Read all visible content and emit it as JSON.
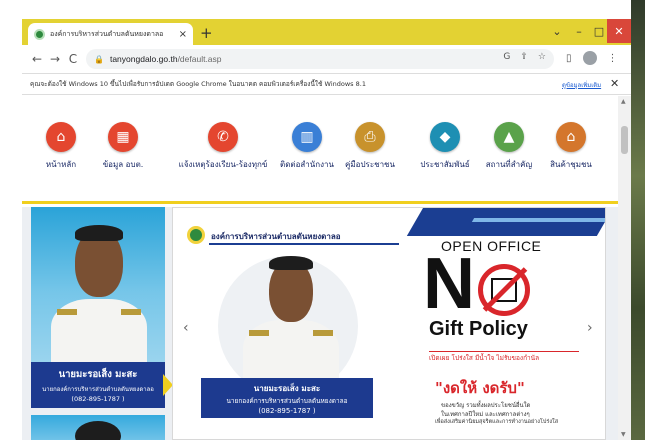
{
  "browser": {
    "tab_title": "องค์การบริหารส่วนตำบลตันหยงดาลอ",
    "tab_close": "×",
    "new_tab": "+",
    "url_host": "tanyongdalo.go.th",
    "url_path": "/default.asp",
    "window_controls": {
      "chevron": "⌄",
      "minimize": "–",
      "maximize": "□",
      "close": "✕"
    },
    "nav": {
      "back": "←",
      "forward": "→",
      "reload": "C"
    }
  },
  "infobar": {
    "message": "คุณจะต้องใช้ Windows 10 ขึ้นไปเพื่อรับการอัปเดต Google Chrome ในอนาคต คอมพิวเตอร์เครื่องนี้ใช้ Windows 8.1",
    "learn_more": "ดูข้อมูลเพิ่มเติม",
    "close": "✕"
  },
  "menu": {
    "items": [
      {
        "label": "หน้าหลัก",
        "icon": "home-icon",
        "color": "#e4462f"
      },
      {
        "label": "ข้อมูล อบต.",
        "icon": "building-icon",
        "color": "#e4462f"
      },
      {
        "label": "แจ้งเหตุร้องเรียน-ร้องทุกข์",
        "icon": "phone-icon",
        "color": "#e4462f"
      },
      {
        "label": "ติดต่อสำนักงาน",
        "icon": "office-icon",
        "color": "#3a7fd6"
      },
      {
        "label": "คู่มือประชาชน",
        "icon": "manual-icon",
        "color": "#c8922c"
      },
      {
        "label": "ประชาสัมพันธ์",
        "icon": "pr-icon",
        "color": "#1e8fb3"
      },
      {
        "label": "สถานที่สำคัญ",
        "icon": "place-icon",
        "color": "#5aa24a"
      },
      {
        "label": "สินค้าชุมชน",
        "icon": "shop-icon",
        "color": "#d4762c"
      }
    ]
  },
  "profile": {
    "name": "นายมะรอเส็ง มะสะ",
    "position": "นายกองค์การบริหารส่วนตำบลตันหยงดาลอ",
    "phone": "(082-895-1787 )"
  },
  "slide": {
    "org_name": "องค์การบริหารส่วนตำบลตันหยงดาลอ",
    "person_name": "นายมะรอเส็ง มะสะ",
    "person_position": "นายกองค์การบริหารส่วนตำบลตันหยงดาลอ",
    "person_phone": "(082-895-1787 )",
    "open_office": "OPEN OFFICE",
    "big_n": "N",
    "gift_policy": "Gift Policy",
    "red_line": "เปิดเผย โปร่งใส มีน้ำใจ ไม่รับของกำนัล",
    "stop_text": "\"งดให้ งดรับ\"",
    "small_1": "ของขวัญ รวมทั้งผลประโยชน์อื่นใด",
    "small_2": "ในเทศกาลปีใหม่ และเทศกาลต่างๆ",
    "small_3": "เพื่อส่งเสริมค่านิยมสุจริตและการทำงานอย่างโปร่งใส",
    "prev": "‹",
    "next": "›"
  }
}
